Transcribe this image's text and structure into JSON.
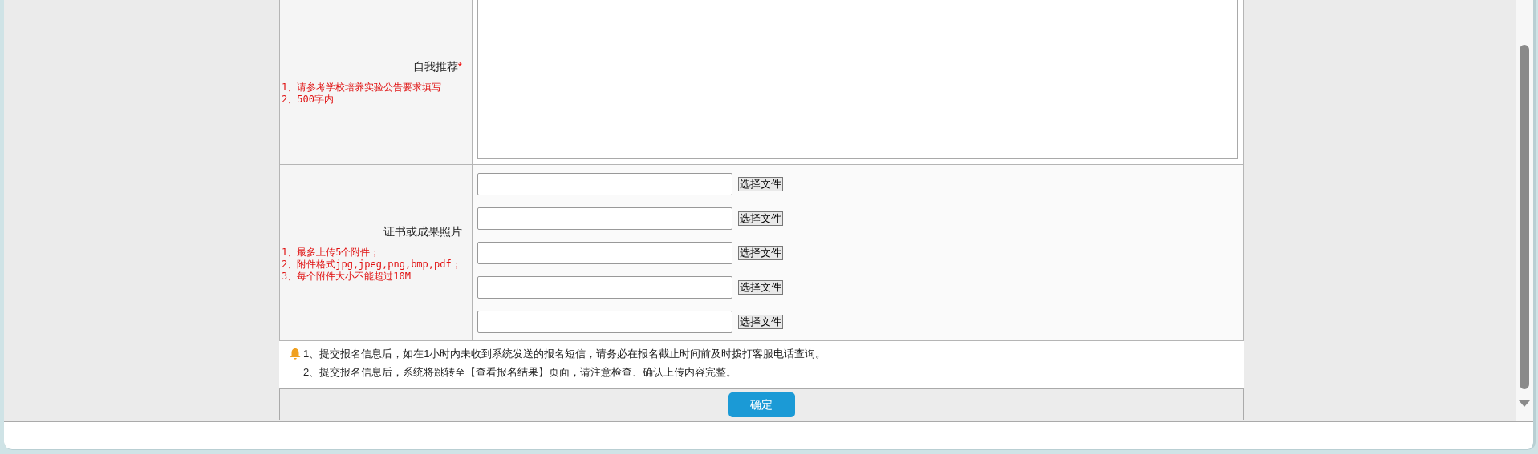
{
  "form": {
    "rows": [
      {
        "kind": "textarea",
        "label": "自我推荐",
        "required_mark": "*",
        "hints": [
          "1、请参考学校培养实验公告要求填写",
          "2、500字内"
        ]
      },
      {
        "kind": "files",
        "label": "证书或成果照片",
        "hints": [
          "1、最多上传5个附件；",
          "2、附件格式jpg,jpeg,png,bmp,pdf；",
          "3、每个附件大小不能超过10M"
        ],
        "files": [
          {
            "button": "选择文件"
          },
          {
            "button": "选择文件"
          },
          {
            "button": "选择文件"
          },
          {
            "button": "选择文件"
          },
          {
            "button": "选择文件"
          }
        ]
      }
    ]
  },
  "notes": [
    "1、提交报名信息后，如在1小时内未收到系统发送的报名短信，请务必在报名截止时间前及时拨打客服电话查询。",
    "2、提交报名信息后，系统将跳转至【查看报名结果】页面，请注意检查、确认上传内容完整。"
  ],
  "submit": "确定"
}
